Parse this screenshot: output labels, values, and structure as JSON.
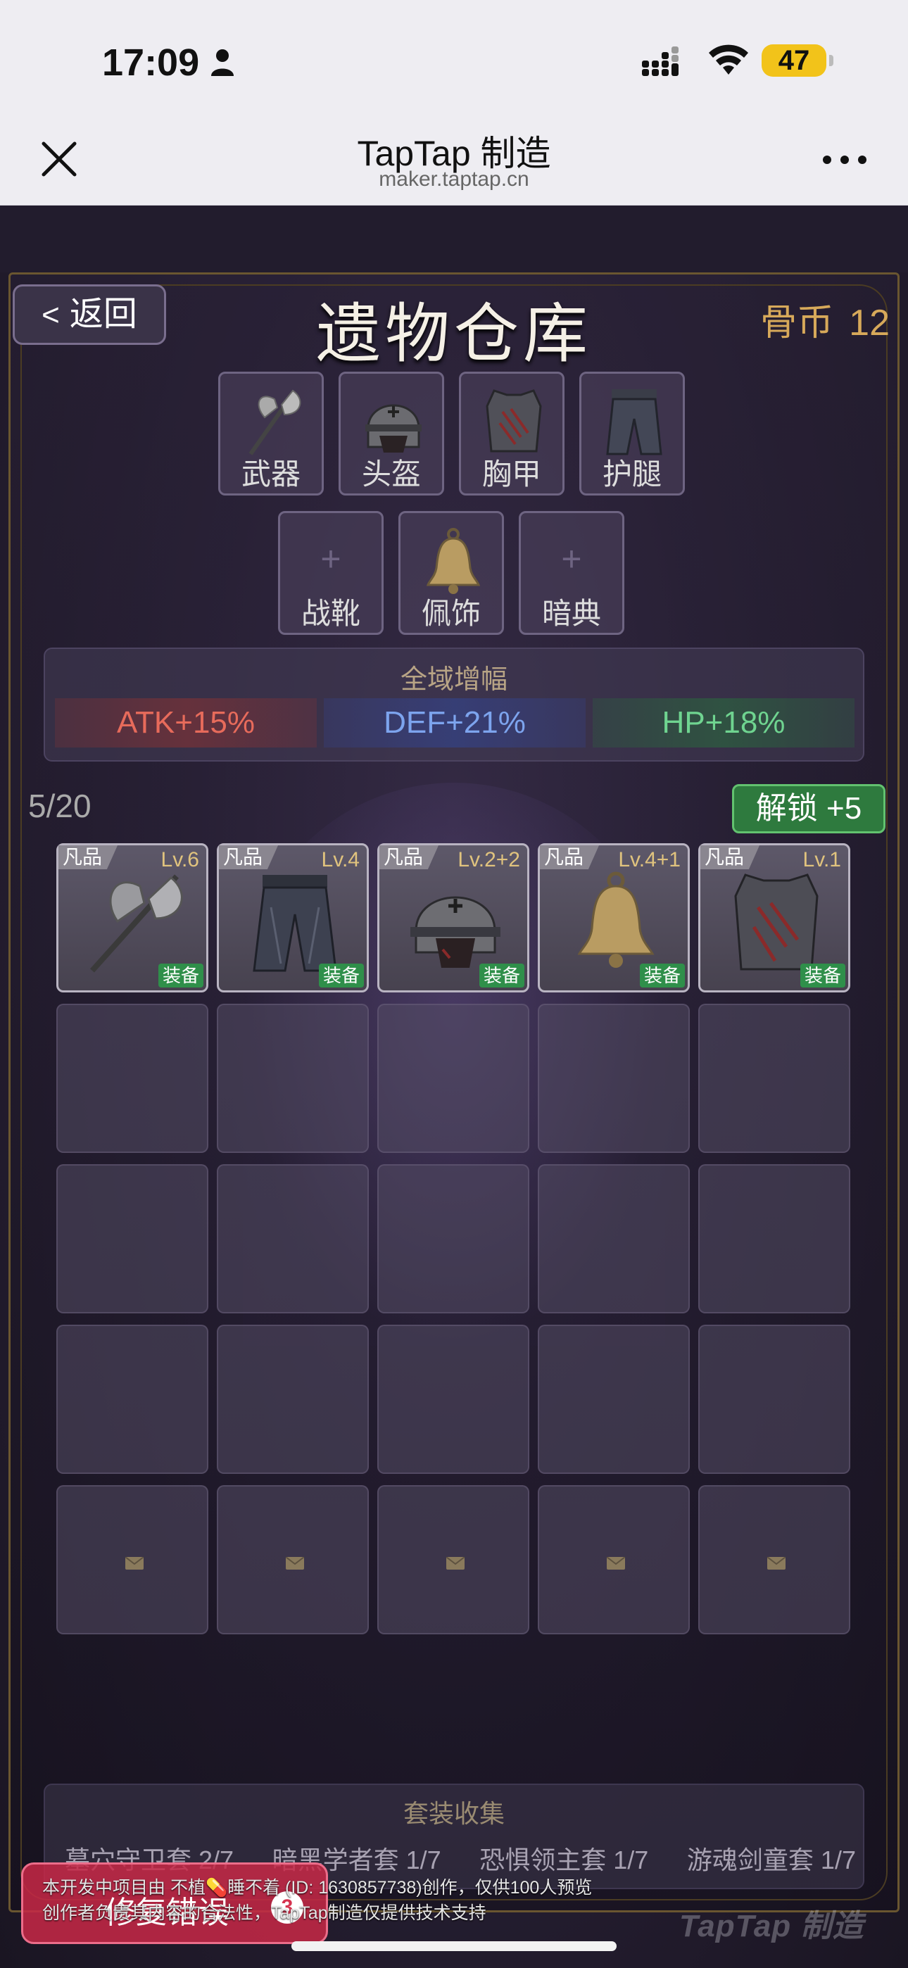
{
  "status_bar": {
    "time": "17:09",
    "battery": "47"
  },
  "browser": {
    "title": "TapTap 制造",
    "url": "maker.taptap.cn"
  },
  "header": {
    "back_label": "返回",
    "title": "遗物仓库",
    "currency_label": "骨币",
    "currency_value": "12"
  },
  "equipment_slots": [
    {
      "label": "武器",
      "icon": "axe-icon"
    },
    {
      "label": "头盔",
      "icon": "helmet-icon"
    },
    {
      "label": "胸甲",
      "icon": "chestplate-icon"
    },
    {
      "label": "护腿",
      "icon": "leggings-icon"
    },
    {
      "label": "战靴",
      "icon": "plus-icon"
    },
    {
      "label": "佩饰",
      "icon": "bell-icon"
    },
    {
      "label": "暗典",
      "icon": "plus-icon"
    }
  ],
  "boost": {
    "title": "全域增幅",
    "atk": "ATK+15%",
    "def": "DEF+21%",
    "hp": "HP+18%"
  },
  "inventory": {
    "capacity": "5/20",
    "unlock_label": "解锁 +5",
    "items": [
      {
        "rarity": "凡品",
        "level": "Lv.6",
        "equip": "装备",
        "icon": "axe-icon"
      },
      {
        "rarity": "凡品",
        "level": "Lv.4",
        "equip": "装备",
        "icon": "leggings-icon"
      },
      {
        "rarity": "凡品",
        "level": "Lv.2+2",
        "equip": "装备",
        "icon": "helmet-icon"
      },
      {
        "rarity": "凡品",
        "level": "Lv.4+1",
        "equip": "装备",
        "icon": "bell-icon"
      },
      {
        "rarity": "凡品",
        "level": "Lv.1",
        "equip": "装备",
        "icon": "chestplate-icon"
      }
    ]
  },
  "set_collection": {
    "title": "套装收集",
    "sets": [
      "墓穴守卫套 2/7",
      "暗黑学者套 1/7",
      "恐惧领主套 1/7",
      "游魂剑童套 1/7"
    ]
  },
  "fix_errors": {
    "label": "修复错误",
    "count": "3"
  },
  "dev_note": {
    "line1": "本开发中项目由 不植💊睡不着 (ID: 1630857738)创作，仅供100人预览",
    "line2": "创作者负责其内容的合法性，TapTap制造仅提供技术支持"
  },
  "watermark": "TapTap 制造"
}
